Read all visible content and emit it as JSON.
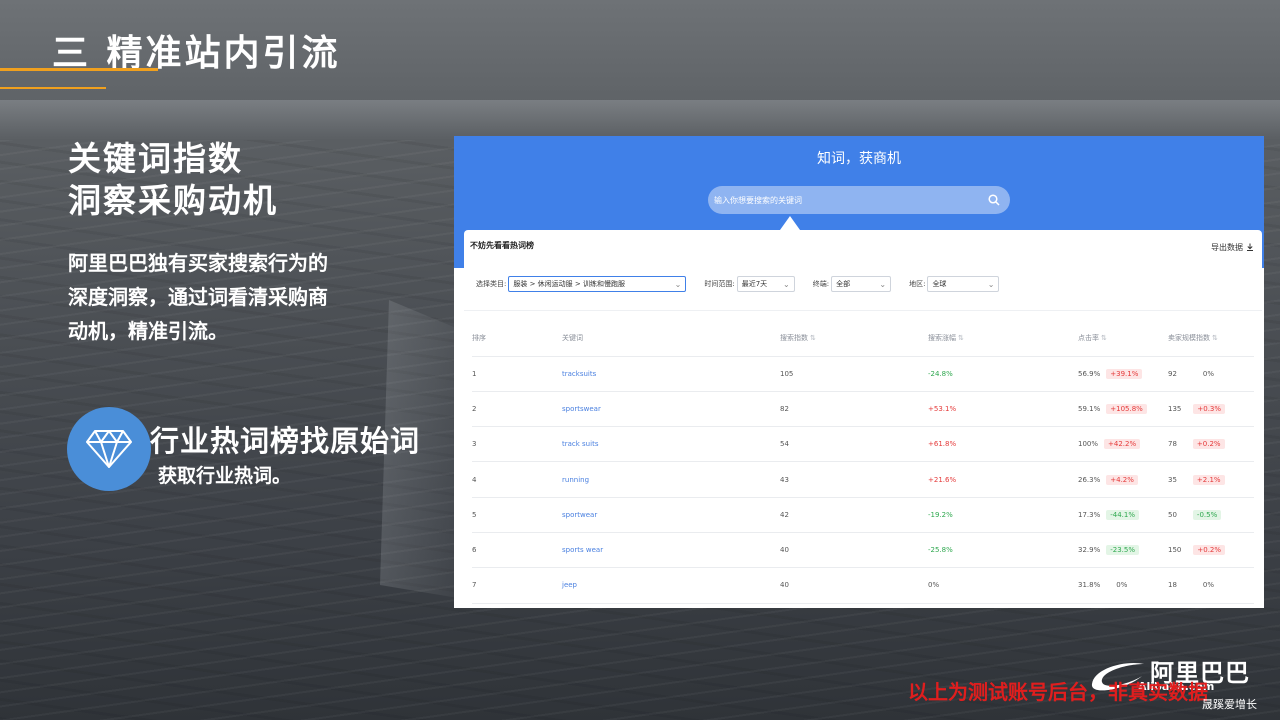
{
  "slide": {
    "heading": "三 精准站内引流",
    "subtitle_line1": "关键词指数",
    "subtitle_line2": "洞察采购动机",
    "desc_line1": "阿里巴巴独有买家搜索行为的",
    "desc_line2": "深度洞察，通过词看清采购商",
    "desc_line3": "动机，精准引流。",
    "feature_title": "行业热词榜找原始词",
    "feature_sub": "获取行业热词。",
    "disclaimer": "以上为测试账号后台，非真实数据",
    "logo_cn": "阿里巴巴",
    "logo_en": "Alibaba.com",
    "watermark": "晟蹊爱增长",
    "accent_color": "#f0a01e",
    "icon_bg_color": "#4a8ed8"
  },
  "app": {
    "hero_title": "知词，获商机",
    "search_placeholder": "输入你想要搜索的关键词",
    "card_title": "不妨先看看热词榜",
    "export_label": "导出数据",
    "filters": {
      "category_label": "选择类目:",
      "category_value": "服装 > 休闲运动服 > 训练和慢跑服",
      "time_label": "时间范围:",
      "time_value": "最近7天",
      "terminal_label": "终端:",
      "terminal_value": "全部",
      "region_label": "地区:",
      "region_value": "全球"
    },
    "columns": [
      "排序",
      "关键词",
      "搜索指数",
      "搜索涨幅",
      "点击率",
      "卖家规模指数"
    ],
    "rows": [
      {
        "rank": "1",
        "keyword": "tracksuits",
        "search_index": "105",
        "growth": "-24.8%",
        "ctr": "56.9%",
        "ctr_change": "+39.1%",
        "seller_index": "92",
        "seller_change": "0%"
      },
      {
        "rank": "2",
        "keyword": "sportswear",
        "search_index": "82",
        "growth": "+53.1%",
        "ctr": "59.1%",
        "ctr_change": "+105.8%",
        "seller_index": "135",
        "seller_change": "+0.3%"
      },
      {
        "rank": "3",
        "keyword": "track suits",
        "search_index": "54",
        "growth": "+61.8%",
        "ctr": "100%",
        "ctr_change": "+42.2%",
        "seller_index": "78",
        "seller_change": "+0.2%"
      },
      {
        "rank": "4",
        "keyword": "running",
        "search_index": "43",
        "growth": "+21.6%",
        "ctr": "26.3%",
        "ctr_change": "+4.2%",
        "seller_index": "35",
        "seller_change": "+2.1%"
      },
      {
        "rank": "5",
        "keyword": "sportwear",
        "search_index": "42",
        "growth": "-19.2%",
        "ctr": "17.3%",
        "ctr_change": "-44.1%",
        "seller_index": "50",
        "seller_change": "-0.5%"
      },
      {
        "rank": "6",
        "keyword": "sports wear",
        "search_index": "40",
        "growth": "-25.8%",
        "ctr": "32.9%",
        "ctr_change": "-23.5%",
        "seller_index": "150",
        "seller_change": "+0.2%"
      },
      {
        "rank": "7",
        "keyword": "jeep",
        "search_index": "40",
        "growth": "0%",
        "ctr": "31.8%",
        "ctr_change": "0%",
        "seller_index": "18",
        "seller_change": "0%"
      }
    ]
  }
}
